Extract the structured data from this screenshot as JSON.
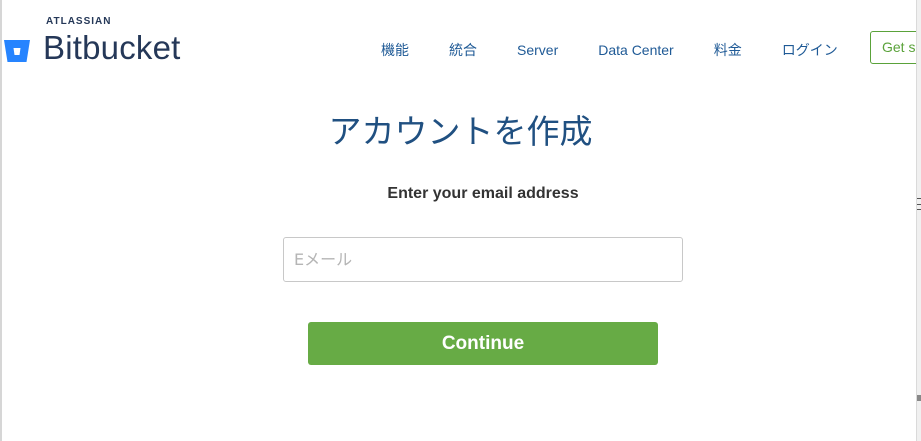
{
  "brand": {
    "company": "ATLASSIAN",
    "product": "Bitbucket",
    "icon": "bitbucket-bucket-icon",
    "color": "#2684ff"
  },
  "nav": {
    "items": [
      {
        "label": "機能"
      },
      {
        "label": "統合"
      },
      {
        "label": "Server"
      },
      {
        "label": "Data Center"
      },
      {
        "label": "料金"
      },
      {
        "label": "ログイン"
      }
    ],
    "cta_label": "Get s",
    "link_color": "#1f5a96",
    "cta_color": "#5aa23a"
  },
  "form": {
    "title": "アカウントを作成",
    "prompt": "Enter your email address",
    "email_placeholder": "Eメール",
    "email_value": "",
    "submit_label": "Continue",
    "submit_color": "#67ab45",
    "title_color": "#205081"
  }
}
